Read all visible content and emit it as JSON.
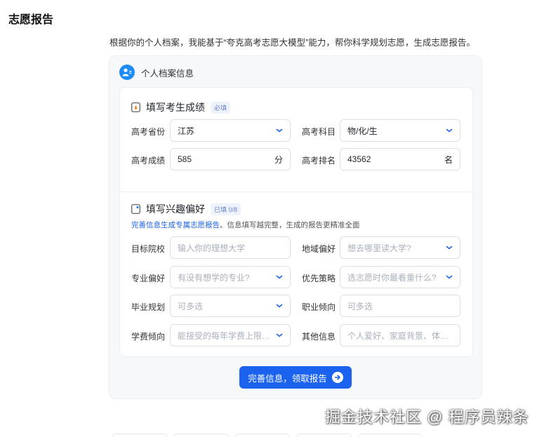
{
  "page_title": "志愿报告",
  "intro": "根据你的个人档案，我能基于“夸克高考志愿大模型”能力，帮你科学规划志愿，生成志愿报告。",
  "card": {
    "header_label": "个人档案信息"
  },
  "scores_section": {
    "title": "填写考生成绩",
    "badge": "必填",
    "province": {
      "label": "高考省份",
      "value": "江苏"
    },
    "subjects": {
      "label": "高考科目",
      "value": "物/化/生"
    },
    "score": {
      "label": "高考成绩",
      "value": "585",
      "unit": "分"
    },
    "rank": {
      "label": "高考排名",
      "value": "43562",
      "unit": "名"
    }
  },
  "interests_section": {
    "title": "填写兴趣偏好",
    "badge": "已填 0/8",
    "hint_link": "完善信息生成专属志愿报告",
    "hint_rest": "。信息填写越完整，生成的报告更精准全面",
    "fields": {
      "target_school": {
        "label": "目标院校",
        "placeholder": "输入你的理想大学"
      },
      "region": {
        "label": "地域偏好",
        "placeholder": "想去哪里读大学?"
      },
      "major": {
        "label": "专业偏好",
        "placeholder": "有没有想学的专业?"
      },
      "strategy": {
        "label": "优先策略",
        "placeholder": "选志愿时你最看重什么?"
      },
      "graduation": {
        "label": "毕业规划",
        "placeholder": "可多选"
      },
      "career": {
        "label": "职业倾向",
        "placeholder": "可多选"
      },
      "tuition": {
        "label": "学费倾向",
        "placeholder": "能接受的每年学费上限是..."
      },
      "other": {
        "label": "其他信息",
        "placeholder": "个人爱好、家庭背景、体检情况..."
      }
    }
  },
  "submit_label": "完善信息，领取报告",
  "watermark": "掘金技术社区 @ 程序员辣条",
  "colors": {
    "primary": "#1b63ee",
    "accent_icon": "#1e8cf8",
    "link": "#1a5fe0"
  }
}
